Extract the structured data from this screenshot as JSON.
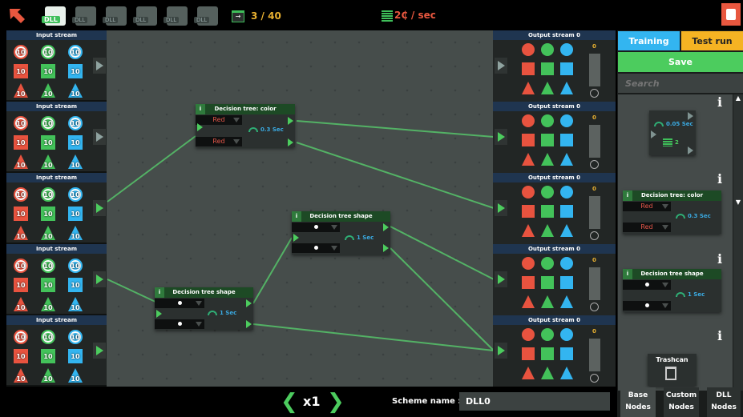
{
  "topbar": {
    "files": [
      "DLL",
      "DLL",
      "DLL",
      "DLL",
      "DLL",
      "DLL"
    ],
    "progress": "3 / 40",
    "rate": "2₵ / sec",
    "colors": {
      "accent_red": "#e8573f",
      "progress": "#e8b030"
    }
  },
  "input_streams": [
    {
      "title": "Input stream",
      "counts": [
        "10",
        "10",
        "10",
        "10",
        "10",
        "10",
        "10",
        "10",
        "10"
      ]
    },
    {
      "title": "Input stream",
      "counts": [
        "10",
        "10",
        "10",
        "10",
        "10",
        "10",
        "10",
        "10",
        "10"
      ]
    },
    {
      "title": "Input stream",
      "counts": [
        "10",
        "10",
        "10",
        "10",
        "10",
        "10",
        "10",
        "10",
        "10"
      ]
    },
    {
      "title": "Input stream",
      "counts": [
        "10",
        "10",
        "10",
        "10",
        "10",
        "10",
        "10",
        "10",
        "10"
      ]
    },
    {
      "title": "Input stream",
      "counts": [
        "10",
        "10",
        "10",
        "10",
        "10",
        "10",
        "10",
        "10",
        "10"
      ]
    }
  ],
  "output_streams": [
    {
      "title": "Output stream 0",
      "count": "0"
    },
    {
      "title": "Output stream 0",
      "count": "0"
    },
    {
      "title": "Output stream 0",
      "count": "0"
    },
    {
      "title": "Output stream 0",
      "count": "0"
    },
    {
      "title": "Output stream 0",
      "count": "0"
    }
  ],
  "token_colors": [
    "#e8533f",
    "#43c25a",
    "#33b5f0"
  ],
  "nodes": {
    "color": {
      "title": "Decision tree: color",
      "sel1": "Red",
      "sel2": "Red",
      "speed": "0.3 Sec",
      "info": "i"
    },
    "shape_mid": {
      "title": "Decision tree shape",
      "speed": "1 Sec",
      "info": "i"
    },
    "shape_low": {
      "title": "Decision tree shape",
      "speed": "1 Sec",
      "info": "i"
    }
  },
  "sidebar": {
    "training": "Training",
    "test_run": "Test run",
    "save": "Save",
    "search_placeholder": "Search",
    "palette": {
      "splitter_speed": "0.05 Sec",
      "splitter_count": "2",
      "color_title": "Decision tree: color",
      "color_sel1": "Red",
      "color_sel2": "Red",
      "color_speed": "0.3 Sec",
      "shape_title": "Decision tree shape",
      "shape_speed": "1 Sec",
      "trash": "Trashcan",
      "info": "i"
    },
    "tabs": [
      {
        "l1": "Base",
        "l2": "Nodes"
      },
      {
        "l1": "Custom",
        "l2": "Nodes"
      },
      {
        "l1": "DLL",
        "l2": "Nodes"
      }
    ]
  },
  "bottombar": {
    "speed": "x1",
    "scheme_label": "Scheme name :",
    "scheme_name": "DLL0"
  }
}
